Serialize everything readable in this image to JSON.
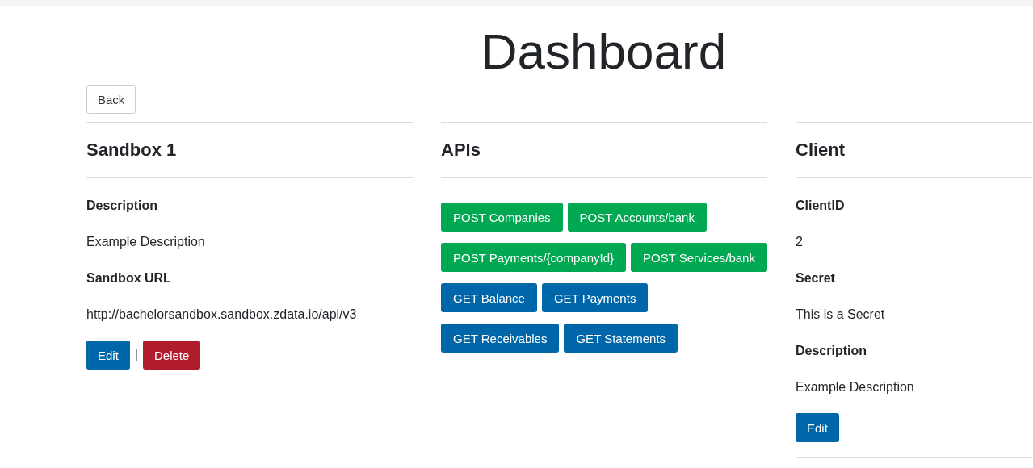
{
  "title": "Dashboard",
  "back_button": "Back",
  "sandbox": {
    "heading": "Sandbox 1",
    "fields": [
      {
        "label": "Description",
        "value": "Example Description"
      },
      {
        "label": "Sandbox URL",
        "value": "http://bachelorsandbox.sandbox.zdata.io/api/v3"
      }
    ],
    "edit_button": "Edit",
    "separator": "|",
    "delete_button": "Delete"
  },
  "apis": {
    "heading": "APIs",
    "buttons": [
      {
        "label": "POST Companies",
        "kind": "post"
      },
      {
        "label": "POST Accounts/bank",
        "kind": "post"
      },
      {
        "label": "POST Payments/{companyId}",
        "kind": "post"
      },
      {
        "label": "POST Services/bank",
        "kind": "post"
      },
      {
        "label": "GET Balance",
        "kind": "get"
      },
      {
        "label": "GET Payments",
        "kind": "get"
      },
      {
        "label": "GET Receivables",
        "kind": "get"
      },
      {
        "label": "GET Statements",
        "kind": "get"
      }
    ]
  },
  "client": {
    "heading": "Client",
    "fields": [
      {
        "label": "ClientID",
        "value": "2"
      },
      {
        "label": "Secret",
        "value": "This is a Secret"
      },
      {
        "label": "Description",
        "value": "Example Description"
      }
    ],
    "edit_button": "Edit"
  }
}
